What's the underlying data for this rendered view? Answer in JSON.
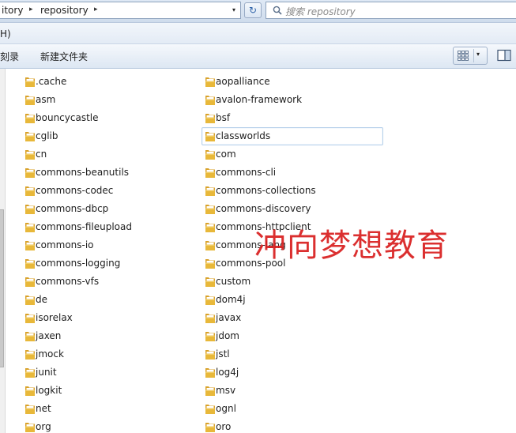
{
  "address_bar": {
    "crumbs": [
      "itory",
      "repository"
    ],
    "separator": "▸",
    "dropdown_glyph": "▾",
    "refresh_glyph": "↻"
  },
  "search": {
    "placeholder": "搜索 repository",
    "icon": "search-icon"
  },
  "menu": {
    "partial_item": "H)"
  },
  "toolbar": {
    "burn_label": "刻录",
    "new_folder_label": "新建文件夹",
    "view_icon": "view-thumbnails-icon",
    "view_chevron": "▾",
    "preview_pane_icon": "preview-pane-icon"
  },
  "colors": {
    "folder": "#e8b83a",
    "hover_border": "#b6d0ea",
    "watermark": "#d81e1e"
  },
  "files": {
    "column_left": [
      ".cache",
      "asm",
      "bouncycastle",
      "cglib",
      "cn",
      "commons-beanutils",
      "commons-codec",
      "commons-dbcp",
      "commons-fileupload",
      "commons-io",
      "commons-logging",
      "commons-vfs",
      "de",
      "isorelax",
      "jaxen",
      "jmock",
      "junit",
      "logkit",
      "net",
      "org"
    ],
    "column_right": [
      "aopalliance",
      "avalon-framework",
      "bsf",
      "classworlds",
      "com",
      "commons-cli",
      "commons-collections",
      "commons-discovery",
      "commons-httpclient",
      "commons-lang",
      "commons-pool",
      "custom",
      "dom4j",
      "javax",
      "jdom",
      "jstl",
      "log4j",
      "msv",
      "ognl",
      "oro"
    ],
    "hovered": "classworlds"
  },
  "watermark": {
    "text": "冲向梦想教育"
  }
}
